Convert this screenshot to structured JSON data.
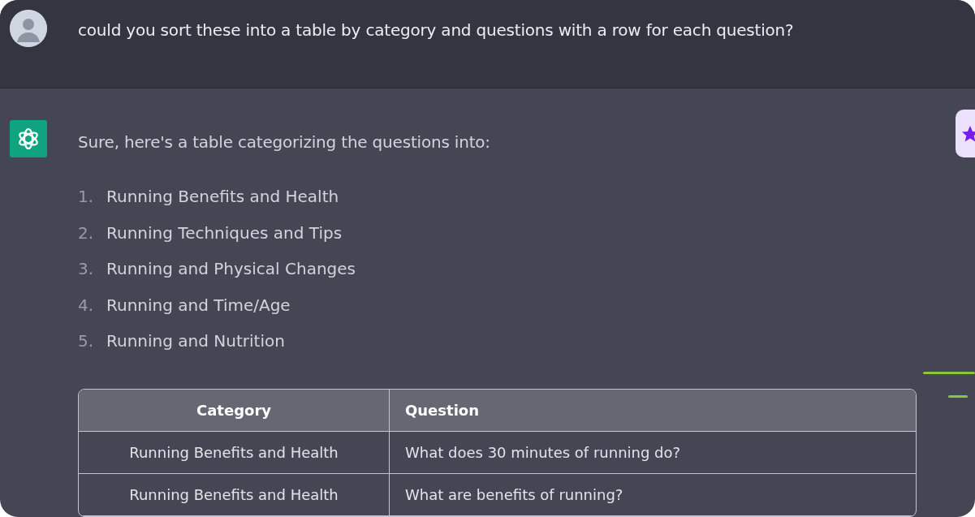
{
  "user_message": {
    "text": "could you sort these into a table by category and questions with a row for each question?"
  },
  "assistant_message": {
    "intro": "Sure, here's a table categorizing the questions into:",
    "list": [
      {
        "number": "1.",
        "text": "Running Benefits and Health"
      },
      {
        "number": "2.",
        "text": "Running Techniques and Tips"
      },
      {
        "number": "3.",
        "text": "Running and Physical Changes"
      },
      {
        "number": "4.",
        "text": "Running and Time/Age"
      },
      {
        "number": "5.",
        "text": "Running and Nutrition"
      }
    ],
    "table": {
      "columns": [
        "Category",
        "Question"
      ],
      "rows": [
        [
          "Running Benefits and Health",
          "What does 30 minutes of running do?"
        ],
        [
          "Running Benefits and Health",
          "What are benefits of running?"
        ]
      ]
    }
  }
}
